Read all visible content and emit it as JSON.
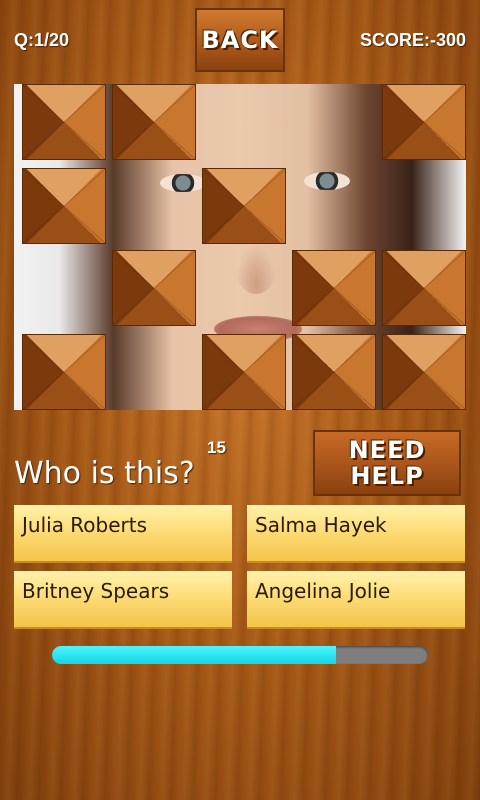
{
  "header": {
    "question_counter": "Q:1/20",
    "back_label": "BACK",
    "score": "SCORE:-300"
  },
  "game": {
    "question": "Who is this?",
    "timer": "15",
    "help_line1": "NEED",
    "help_line2": "HELP",
    "answers": [
      {
        "label": "Julia Roberts"
      },
      {
        "label": "Salma Hayek"
      },
      {
        "label": "Britney Spears"
      },
      {
        "label": "Angelina Jolie"
      }
    ],
    "progress_fraction": 0.755,
    "hidden_tiles": [
      [
        1,
        1,
        0,
        0,
        1
      ],
      [
        1,
        0,
        1,
        0,
        0
      ],
      [
        0,
        1,
        0,
        1,
        1
      ],
      [
        1,
        0,
        1,
        1,
        1
      ]
    ]
  },
  "colors": {
    "progress_fill": "#14d6e6",
    "progress_track": "#7e7e7e",
    "answer_button": "#fbd86e"
  }
}
